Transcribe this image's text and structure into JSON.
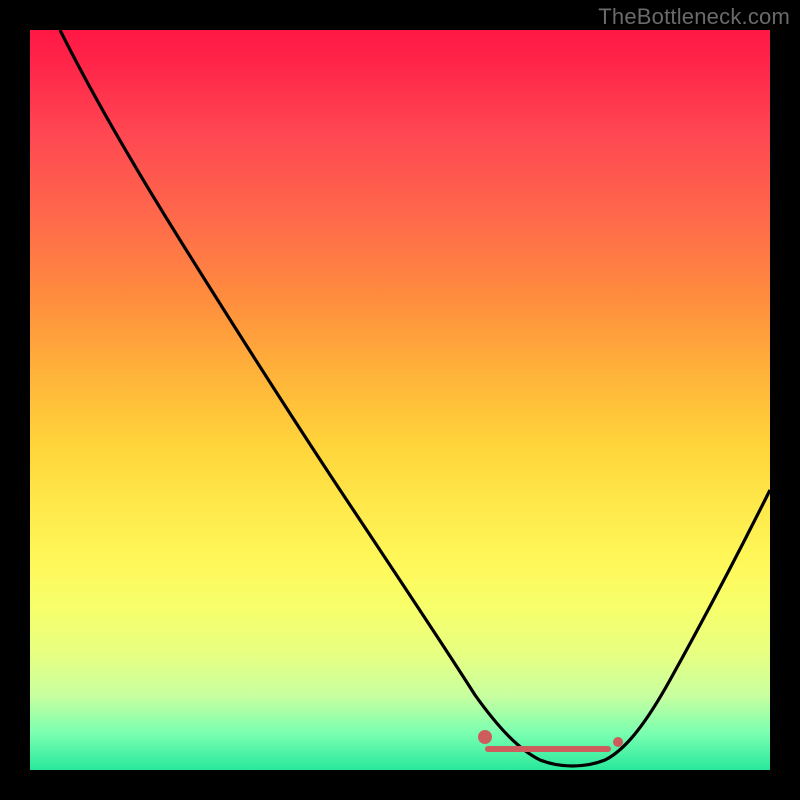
{
  "watermark": "TheBottleneck.com",
  "chart_data": {
    "type": "line",
    "title": "",
    "xlabel": "",
    "ylabel": "",
    "xlim": [
      0,
      100
    ],
    "ylim": [
      0,
      100
    ],
    "grid": false,
    "annotations": [],
    "series": [
      {
        "name": "curve",
        "x": [
          4,
          10,
          20,
          30,
          40,
          50,
          58,
          62,
          66,
          70,
          74,
          78,
          82,
          88,
          94,
          100
        ],
        "y": [
          100,
          91,
          76,
          62,
          47,
          32,
          20,
          14,
          8,
          4,
          2,
          2,
          4,
          12,
          24,
          38
        ]
      }
    ],
    "markers": {
      "optimal_range_x": [
        62,
        80
      ],
      "optimal_y": 3,
      "left_marker": {
        "x": 62,
        "y": 6
      },
      "right_marker": {
        "x": 80,
        "y": 5
      }
    },
    "background_gradient": {
      "top_color": "#ff1744",
      "bottom_color": "#28e89c",
      "description": "red-to-green vertical gradient indicating bottleneck severity"
    }
  }
}
